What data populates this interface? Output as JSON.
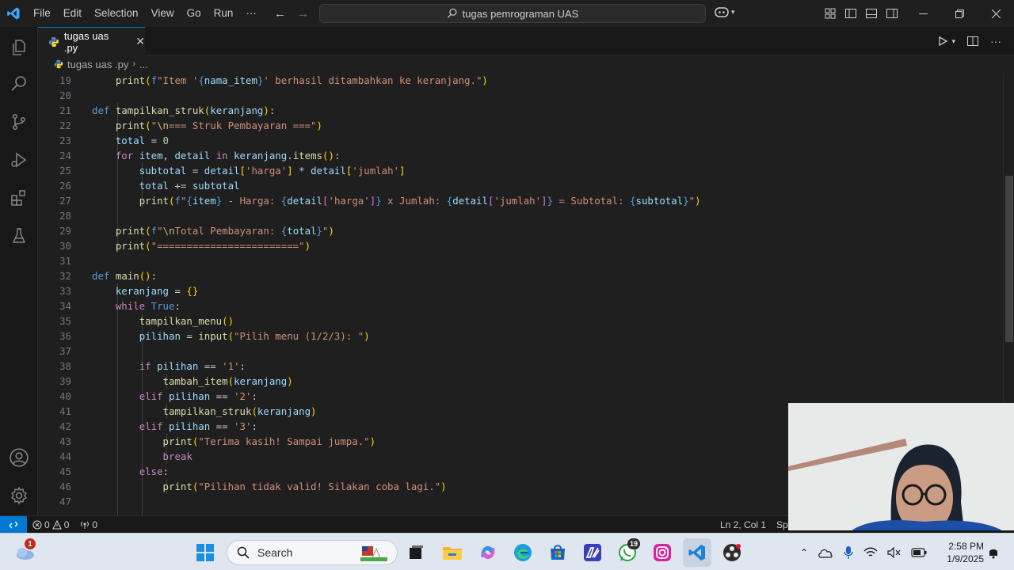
{
  "menu": [
    "File",
    "Edit",
    "Selection",
    "View",
    "Go",
    "Run",
    "···"
  ],
  "command_center": "tugas pemrograman UAS",
  "tab": {
    "label": "tugas uas .py"
  },
  "breadcrumb": {
    "file": "tugas uas .py",
    "more": "..."
  },
  "editor": {
    "lines": [
      {
        "n": "19"
      },
      {
        "n": "20"
      },
      {
        "n": "21"
      },
      {
        "n": "22"
      },
      {
        "n": "23"
      },
      {
        "n": "24"
      },
      {
        "n": "25"
      },
      {
        "n": "26"
      },
      {
        "n": "27"
      },
      {
        "n": "28"
      },
      {
        "n": "29"
      },
      {
        "n": "30"
      },
      {
        "n": "31"
      },
      {
        "n": "32"
      },
      {
        "n": "33"
      },
      {
        "n": "34"
      },
      {
        "n": "35"
      },
      {
        "n": "36"
      },
      {
        "n": "37"
      },
      {
        "n": "38"
      },
      {
        "n": "39"
      },
      {
        "n": "40"
      },
      {
        "n": "41"
      },
      {
        "n": "42"
      },
      {
        "n": "43"
      },
      {
        "n": "44"
      },
      {
        "n": "45"
      },
      {
        "n": "46"
      },
      {
        "n": "47"
      }
    ]
  },
  "status": {
    "errors": "0",
    "warnings": "0",
    "ports": "0",
    "cursor": "Ln 2, Col 1",
    "spaces": "Sp"
  },
  "taskbar": {
    "search_label": "Search",
    "weather_badge": "1",
    "whatsapp_badge": "19",
    "time": "2:58 PM",
    "date": "1/9/2025"
  },
  "colors": {
    "accent": "#0078d4",
    "editor_bg": "#1f1f1f",
    "keyword": "#569cd6",
    "string": "#ce9178",
    "function": "#dcdcaa",
    "variable": "#9cdcfe"
  }
}
